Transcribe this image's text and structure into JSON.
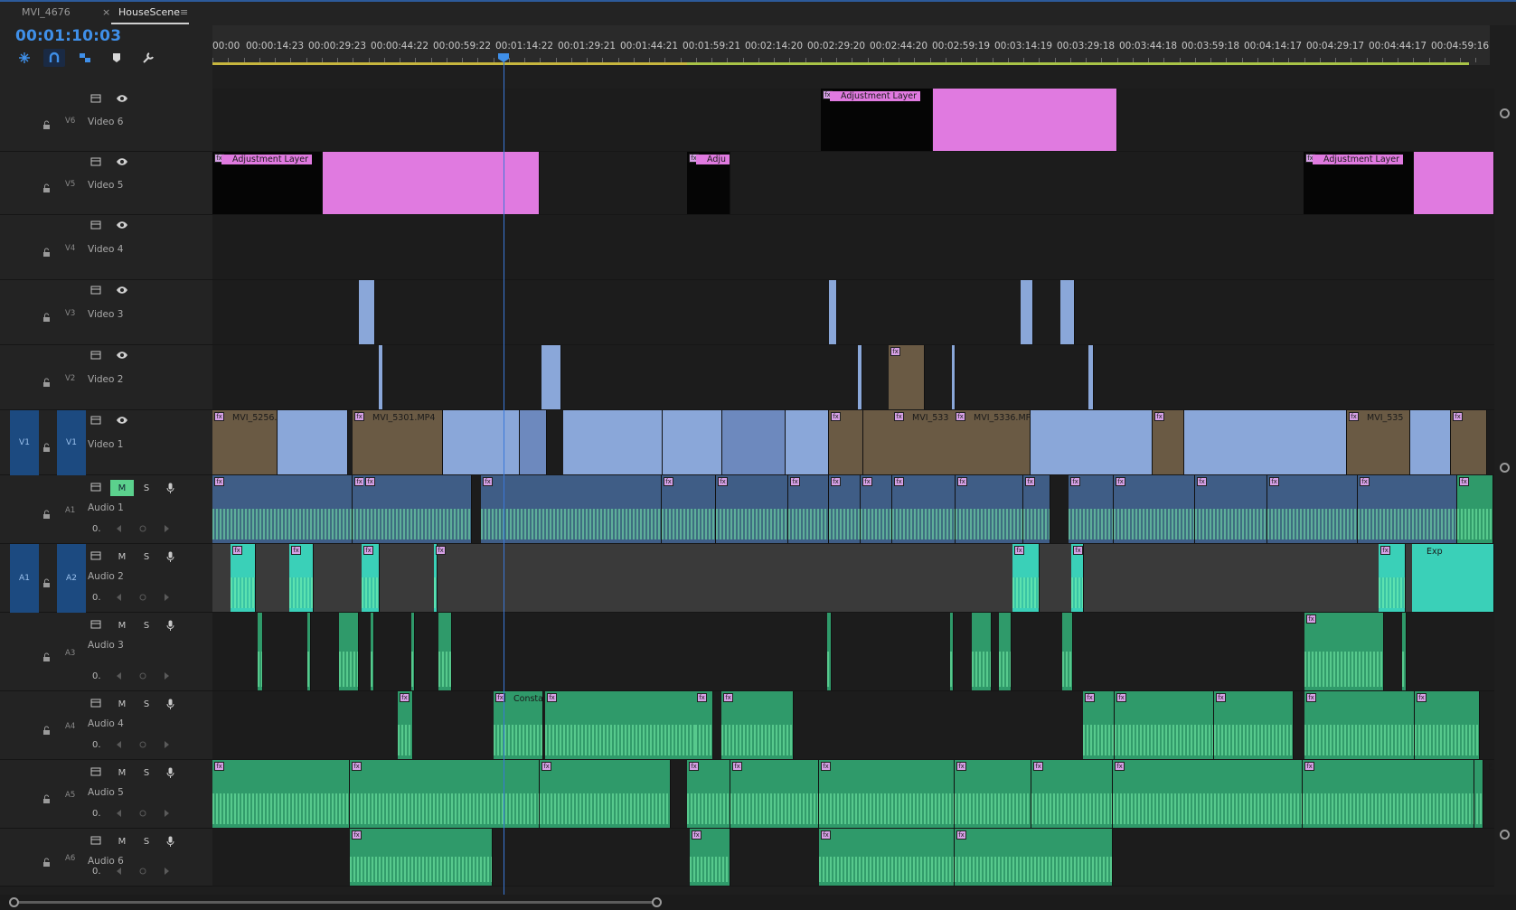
{
  "tabs": [
    {
      "label": "MVI_4676"
    },
    {
      "label": "HouseScene",
      "close": "×",
      "menu": "≡"
    }
  ],
  "timeline": {
    "timecode": "00:01:10:03",
    "ruler_labels": [
      "00:00",
      "00:00:14:23",
      "00:00:29:23",
      "00:00:44:22",
      "00:00:59:22",
      "00:01:14:22",
      "00:01:29:21",
      "00:01:44:21",
      "00:01:59:21",
      "00:02:14:20",
      "00:02:29:20",
      "00:02:44:20",
      "00:02:59:19",
      "00:03:14:19",
      "00:03:29:18",
      "00:03:44:18",
      "00:03:59:18",
      "00:04:14:17",
      "00:04:29:17",
      "00:04:44:17",
      "00:04:59:16"
    ]
  },
  "tools": [
    {
      "icon": "snap-nest-icon"
    },
    {
      "icon": "snap-magnet-icon"
    },
    {
      "icon": "linked-selection-icon"
    },
    {
      "icon": "add-marker-icon"
    },
    {
      "icon": "wrench-settings-icon"
    }
  ],
  "video_tracks": [
    {
      "id": "V6",
      "name": "Video 6"
    },
    {
      "id": "V5",
      "name": "Video 5"
    },
    {
      "id": "V4",
      "name": "Video 4"
    },
    {
      "id": "V3",
      "name": "Video 3"
    },
    {
      "id": "V2",
      "name": "Video 2"
    },
    {
      "id": "V1",
      "name": "Video 1",
      "source_patch": "V1"
    }
  ],
  "audio_tracks": [
    {
      "id": "A1",
      "name": "Audio 1",
      "mute": "M",
      "solo": "S",
      "volume": "0."
    },
    {
      "id": "A2",
      "name": "Audio 2",
      "mute": "M",
      "solo": "S",
      "volume": "0.",
      "source_patch": "A1"
    },
    {
      "id": "A3",
      "name": "Audio 3",
      "mute": "M",
      "solo": "S",
      "volume": "0."
    },
    {
      "id": "A4",
      "name": "Audio 4",
      "mute": "M",
      "solo": "S",
      "volume": "0."
    },
    {
      "id": "A5",
      "name": "Audio 5",
      "mute": "M",
      "solo": "S",
      "volume": "0."
    },
    {
      "id": "A6",
      "name": "Audio 6",
      "mute": "M",
      "solo": "S",
      "volume": "0."
    }
  ],
  "clips": {
    "adjustment_layer": "Adjustment Layer",
    "adjustment_short": "Adju",
    "mvi_5256": "MVI_5256.",
    "mvi_5301": "MVI_5301.MP4",
    "mvi_5336_short": "MVI_533",
    "mvi_5336": "MVI_5336.MP",
    "mvi_5350": "MVI_535",
    "constant": "Constant",
    "exp": "Exp",
    "fx": "fx"
  },
  "colors": {
    "accent_blue": "#3f8fe8",
    "adjustment_magenta": "#e07ae0",
    "video_clip": "#8aa7d9",
    "audio_green": "#2f9a6a",
    "audio_teal": "#3ad0b8",
    "audio1_blue": "#3f5d86",
    "mute_active": "#5bd18d"
  }
}
